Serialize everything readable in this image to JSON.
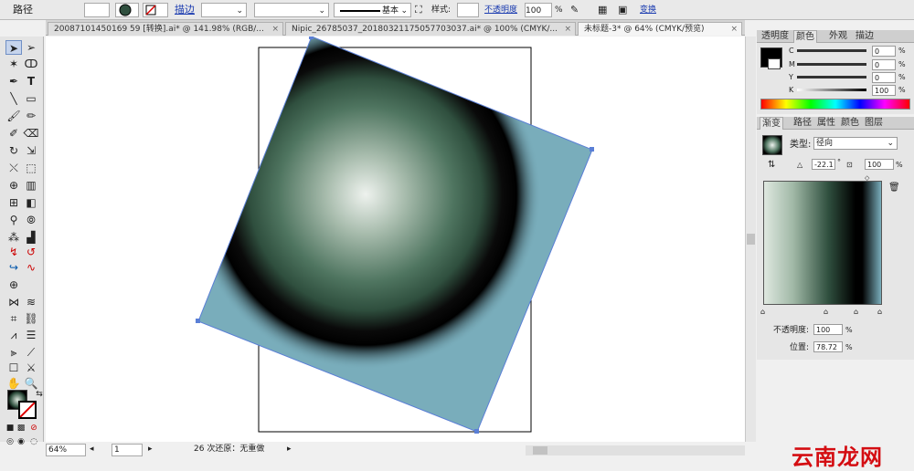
{
  "control_bar": {
    "path_label": "路径",
    "stroke_label": "描边",
    "stroke_line_label": "基本",
    "style_label": "样式:",
    "opacity_label": "不透明度",
    "opacity_value": "100",
    "opacity_unit": "%",
    "transform_label": "变换"
  },
  "doc_tabs": [
    {
      "label": "20087101450169 59 [转换].ai* @ 141.98% (RGB/..."
    },
    {
      "label": "Nipic_26785037_20180321175057703037.ai* @ 100% (CMYK/..."
    },
    {
      "label": "未标题-3* @ 64% (CMYK/预览)"
    }
  ],
  "tab_close": "×",
  "color_panel": {
    "tabs": [
      "透明度",
      "颜色",
      "外观",
      "描边"
    ],
    "channels": [
      {
        "label": "C",
        "value": "0"
      },
      {
        "label": "M",
        "value": "0"
      },
      {
        "label": "Y",
        "value": "0"
      },
      {
        "label": "K",
        "value": "100"
      }
    ],
    "unit": "%"
  },
  "gradient_panel": {
    "tabs": [
      "渐变",
      "路径",
      "属性",
      "颜色",
      "图层"
    ],
    "type_label": "类型:",
    "type_value": "径向",
    "angle_value": "-22.1",
    "angle_unit": "°",
    "aspect_value": "100",
    "aspect_unit": "%",
    "opacity_label": "不透明度:",
    "opacity_value": "100",
    "location_label": "位置:",
    "location_value": "78.72",
    "unit": "%"
  },
  "status_bar": {
    "zoom_value": "64%",
    "page_value": "1",
    "undo_text": "26 次还原：无重做"
  },
  "watermark": "云南龙网",
  "colors": {
    "artboard_rect": "#79adbb",
    "sphere_dark_green": "#2f4f3e",
    "selection_blue": "#5a7fd6"
  }
}
